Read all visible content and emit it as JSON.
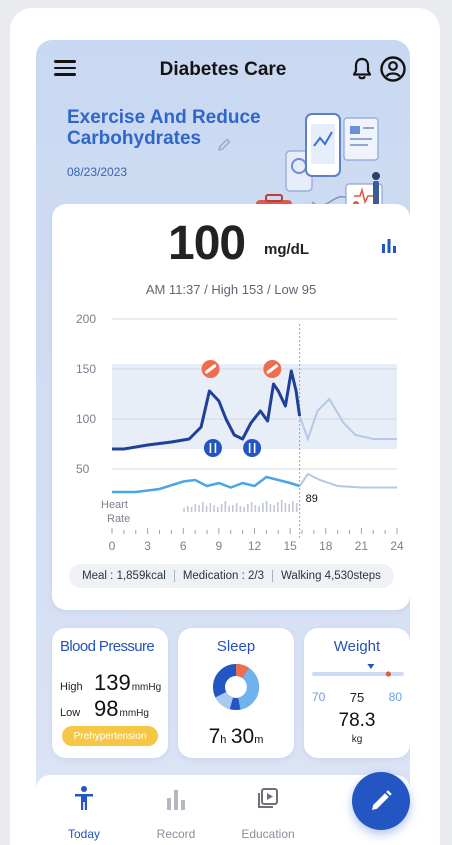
{
  "header": {
    "title": "Diabetes Care"
  },
  "goal": {
    "title_line1": "Exercise And Reduce",
    "title_line2": "Carbohydrates",
    "date": "08/23/2023"
  },
  "glucose": {
    "value": "100",
    "unit": "mg/dL",
    "time": "AM 11:37",
    "high": "High 153",
    "low": "Low 95"
  },
  "chart_data": {
    "type": "line",
    "x_ticks": [
      0,
      3,
      6,
      9,
      12,
      15,
      18,
      21,
      24
    ],
    "y_ticks": [
      50,
      100,
      150,
      200
    ],
    "ylim": [
      35,
      210
    ],
    "xlim": [
      0,
      24
    ],
    "target_range": [
      70,
      155
    ],
    "current_hour": 15.8,
    "glucose_series": [
      [
        0,
        70
      ],
      [
        1,
        70
      ],
      [
        3,
        74
      ],
      [
        5,
        77
      ],
      [
        6.5,
        80
      ],
      [
        7.5,
        92
      ],
      [
        8.2,
        128
      ],
      [
        9,
        118
      ],
      [
        9.6,
        100
      ],
      [
        10.3,
        84
      ],
      [
        11,
        80
      ],
      [
        11.7,
        96
      ],
      [
        12.5,
        108
      ],
      [
        13.1,
        98
      ],
      [
        13.6,
        135
      ],
      [
        14,
        128
      ],
      [
        14.6,
        113
      ],
      [
        15.1,
        148
      ],
      [
        15.5,
        128
      ],
      [
        15.8,
        103
      ]
    ],
    "glucose_forecast": [
      [
        15.8,
        103
      ],
      [
        16.5,
        80
      ],
      [
        17.3,
        108
      ],
      [
        18.3,
        120
      ],
      [
        19.5,
        96
      ],
      [
        20.5,
        84
      ],
      [
        22,
        80
      ],
      [
        24,
        80
      ]
    ],
    "heart_series": [
      [
        0,
        30
      ],
      [
        2,
        30
      ],
      [
        4,
        32
      ],
      [
        6,
        37
      ],
      [
        7,
        38
      ],
      [
        8,
        34
      ],
      [
        9,
        36
      ],
      [
        10,
        33
      ],
      [
        11,
        36
      ],
      [
        12,
        34
      ],
      [
        13,
        40
      ],
      [
        14,
        38
      ],
      [
        15,
        36
      ],
      [
        15.8,
        34
      ]
    ],
    "heart_forecast": [
      [
        15.8,
        34
      ],
      [
        16.5,
        42
      ],
      [
        17.5,
        38
      ],
      [
        19,
        34
      ],
      [
        21,
        33
      ],
      [
        24,
        33
      ]
    ],
    "heart_value_label": "89",
    "heart_label_line1": "Heart",
    "heart_label_line2": "Rate",
    "meal_markers": [
      8.5,
      11.8
    ],
    "medication_markers": [
      8.3,
      13.5
    ]
  },
  "summary": {
    "meal": "Meal : 1,859kcal",
    "medication": "Medication : 2/3",
    "walking": "Walking 4,530steps"
  },
  "blood_pressure": {
    "title": "Blood Pressure",
    "high_label": "High",
    "high_value": "139",
    "low_label": "Low",
    "low_value": "98",
    "unit": "mmHg",
    "status": "Prehypertension"
  },
  "sleep": {
    "title": "Sleep",
    "hours": "7",
    "h_unit": "h",
    "minutes": "30",
    "m_unit": "m"
  },
  "weight": {
    "title": "Weight",
    "min": "70",
    "current_marker": "75",
    "max": "80",
    "value": "78.3",
    "unit": "kg",
    "marker_fraction": 0.64,
    "range_fraction": 0.83
  },
  "nav": {
    "today": "Today",
    "record": "Record",
    "education": "Education"
  },
  "colors": {
    "accent": "#2356c2",
    "glucose_line": "#1f4099",
    "forecast_line": "#b5c8e6",
    "heart_line": "#4aa5e8",
    "medication_marker": "#ef6d4f",
    "range_band": "#e8eef8"
  }
}
